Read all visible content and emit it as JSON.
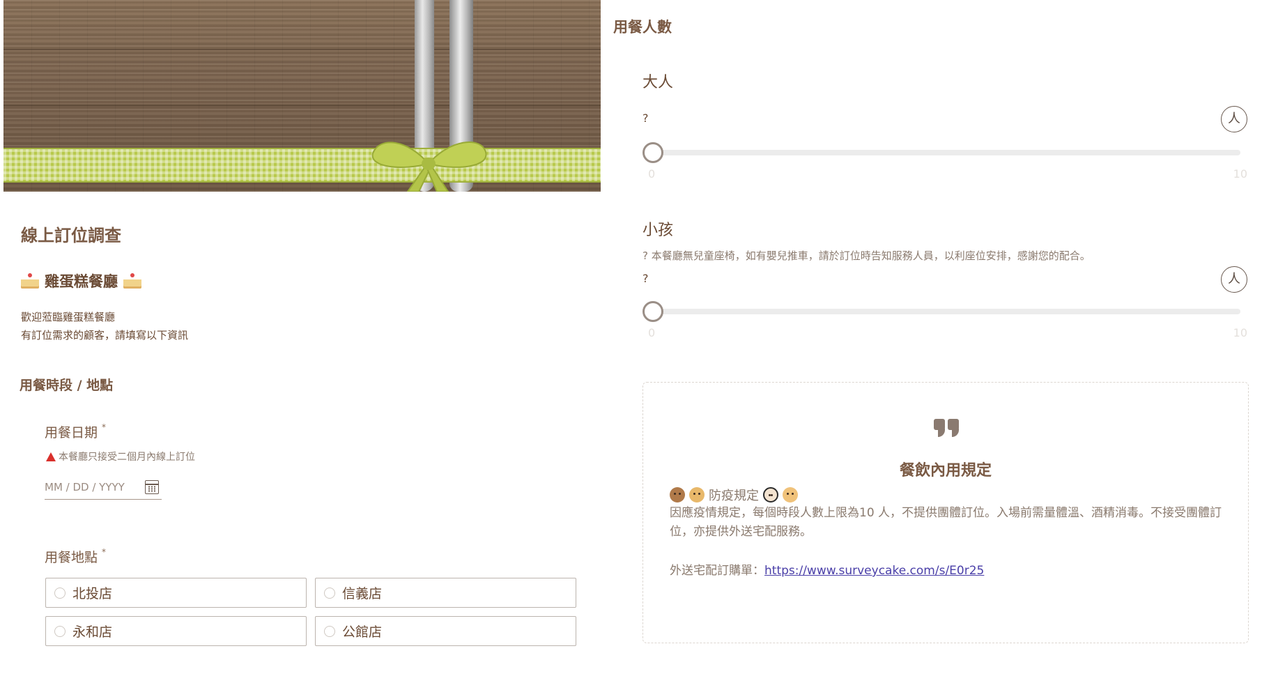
{
  "form": {
    "title": "線上訂位調查",
    "restaurant_name": "雞蛋糕餐廳",
    "welcome_line1": "歡迎蒞臨雞蛋糕餐廳",
    "welcome_line2": "有訂位需求的顧客，請填寫以下資訊"
  },
  "section_time_place": {
    "title": "用餐時段 / 地點",
    "date_question": {
      "label": "用餐日期",
      "required_mark": "*",
      "hint": "本餐廳只接受二個月內線上訂位",
      "placeholder": "MM / DD / YYYY"
    },
    "location_question": {
      "label": "用餐地點",
      "required_mark": "*",
      "options": [
        "北投店",
        "信義店",
        "永和店",
        "公館店"
      ]
    }
  },
  "section_party": {
    "title": "用餐人數",
    "adults": {
      "title": "大人",
      "question_mark": "?",
      "min": "0",
      "max": "10",
      "value_fraction": 0
    },
    "children": {
      "title": "小孩",
      "note": "? 本餐廳無兒童座椅，如有嬰兒推車，請於訂位時告知服務人員，以利座位安排，感謝您的配合。",
      "question_mark": "?",
      "min": "0",
      "max": "10",
      "value_fraction": 0
    },
    "person_icon_glyph": "人"
  },
  "info_card": {
    "title": "餐飲內用規定",
    "rule_heading": "防疫規定",
    "rule_text": "因應疫情規定，每個時段人數上限為10 人，不提供團體訂位。入場前需量體溫、酒精消毒。不接受團體訂位，亦提供外送宅配服務。",
    "delivery_label": "外送宅配訂購單：",
    "delivery_link": "https://www.surveycake.com/s/E0r25"
  },
  "colors": {
    "text_brown": "#7a5a44",
    "link": "#4a3fa8",
    "warning": "#d9302c",
    "ribbon": "#b8c94c"
  }
}
